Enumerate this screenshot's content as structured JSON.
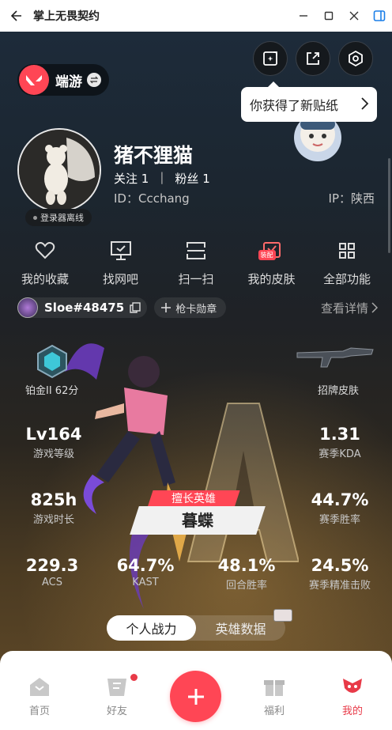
{
  "window": {
    "title": "掌上无畏契约"
  },
  "header": {
    "brand": "端游",
    "sticker_tip": "你获得了新贴纸"
  },
  "profile": {
    "nickname": "猪不狸猫",
    "follow_label": "关注",
    "follow_count": "1",
    "fans_label": "粉丝",
    "fans_count": "1",
    "id_text": "ID：Ccchang",
    "ip_text": "IP：陕西",
    "login_status": "登录器离线"
  },
  "functions": [
    {
      "label": "我的收藏",
      "icon": "heart-icon"
    },
    {
      "label": "找网吧",
      "icon": "monitor-icon"
    },
    {
      "label": "扫一扫",
      "icon": "scan-icon"
    },
    {
      "label": "我的皮肤",
      "icon": "skin-icon",
      "tag": "装配"
    },
    {
      "label": "全部功能",
      "icon": "grid-icon"
    }
  ],
  "account": {
    "name": "Sloe#48475",
    "medal_label": "枪卡勋章",
    "details_label": "查看详情"
  },
  "stats": {
    "rank_label": "铂金II 62分",
    "skin_label": "招牌皮肤",
    "level": {
      "value": "Lv164",
      "label": "游戏等级"
    },
    "kda": {
      "value": "1.31",
      "label": "赛季KDA"
    },
    "playtime": {
      "value": "825h",
      "label": "游戏时长"
    },
    "winrate": {
      "value": "44.7%",
      "label": "赛季胜率"
    },
    "acs": {
      "value": "229.3",
      "label": "ACS"
    },
    "kast": {
      "value": "64.7%",
      "label": "KAST"
    },
    "round_winrate": {
      "value": "48.1%",
      "label": "回合胜率"
    },
    "headshot": {
      "value": "24.5%",
      "label": "赛季精准击败"
    }
  },
  "hero": {
    "ribbon": "擅长英雄",
    "name": "暮蝶"
  },
  "toggle": {
    "personal": "个人战力",
    "hero_data": "英雄数据"
  },
  "nav": {
    "home": "首页",
    "friends": "好友",
    "welfare": "福利",
    "mine": "我的"
  },
  "colors": {
    "accent": "#ff4655",
    "active_nav": "#e83a48"
  }
}
